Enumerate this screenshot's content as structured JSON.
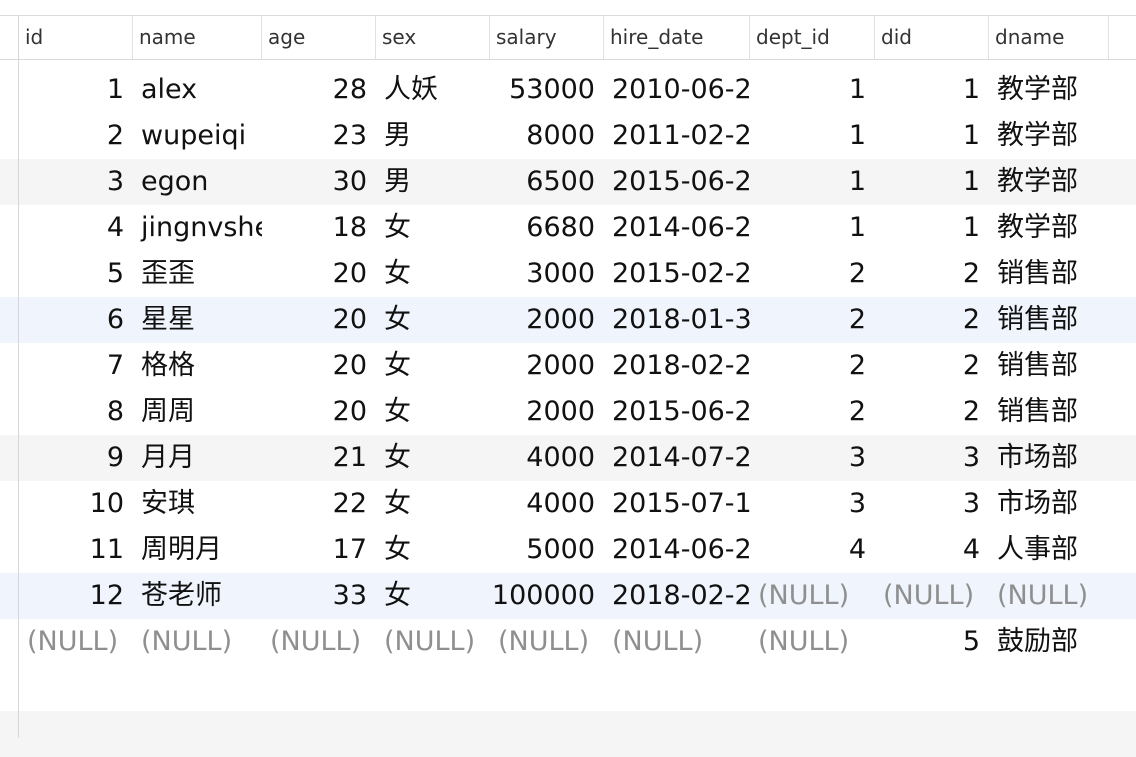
{
  "columns": [
    "id",
    "name",
    "age",
    "sex",
    "salary",
    "hire_date",
    "dept_id",
    "did",
    "dname"
  ],
  "null_label": "(NULL)",
  "rows": [
    {
      "id": "1",
      "name": "alex",
      "age": "28",
      "sex": "人妖",
      "salary": "53000",
      "hire_date": "2010-06-2",
      "dept_id": "1",
      "did": "1",
      "dname": "教学部"
    },
    {
      "id": "2",
      "name": "wupeiqi",
      "age": "23",
      "sex": "男",
      "salary": "8000",
      "hire_date": "2011-02-2",
      "dept_id": "1",
      "did": "1",
      "dname": "教学部"
    },
    {
      "id": "3",
      "name": "egon",
      "age": "30",
      "sex": "男",
      "salary": "6500",
      "hire_date": "2015-06-2",
      "dept_id": "1",
      "did": "1",
      "dname": "教学部"
    },
    {
      "id": "4",
      "name": "jingnvshe",
      "age": "18",
      "sex": "女",
      "salary": "6680",
      "hire_date": "2014-06-2",
      "dept_id": "1",
      "did": "1",
      "dname": "教学部"
    },
    {
      "id": "5",
      "name": "歪歪",
      "age": "20",
      "sex": "女",
      "salary": "3000",
      "hire_date": "2015-02-2",
      "dept_id": "2",
      "did": "2",
      "dname": "销售部"
    },
    {
      "id": "6",
      "name": "星星",
      "age": "20",
      "sex": "女",
      "salary": "2000",
      "hire_date": "2018-01-3",
      "dept_id": "2",
      "did": "2",
      "dname": "销售部"
    },
    {
      "id": "7",
      "name": "格格",
      "age": "20",
      "sex": "女",
      "salary": "2000",
      "hire_date": "2018-02-2",
      "dept_id": "2",
      "did": "2",
      "dname": "销售部"
    },
    {
      "id": "8",
      "name": "周周",
      "age": "20",
      "sex": "女",
      "salary": "2000",
      "hire_date": "2015-06-2",
      "dept_id": "2",
      "did": "2",
      "dname": "销售部"
    },
    {
      "id": "9",
      "name": "月月",
      "age": "21",
      "sex": "女",
      "salary": "4000",
      "hire_date": "2014-07-2",
      "dept_id": "3",
      "did": "3",
      "dname": "市场部"
    },
    {
      "id": "10",
      "name": "安琪",
      "age": "22",
      "sex": "女",
      "salary": "4000",
      "hire_date": "2015-07-1",
      "dept_id": "3",
      "did": "3",
      "dname": "市场部"
    },
    {
      "id": "11",
      "name": "周明月",
      "age": "17",
      "sex": "女",
      "salary": "5000",
      "hire_date": "2014-06-2",
      "dept_id": "4",
      "did": "4",
      "dname": "人事部"
    },
    {
      "id": "12",
      "name": "苍老师",
      "age": "33",
      "sex": "女",
      "salary": "100000",
      "hire_date": "2018-02-2",
      "dept_id": null,
      "did": null,
      "dname": null
    },
    {
      "id": null,
      "name": null,
      "age": null,
      "sex": null,
      "salary": null,
      "hire_date": null,
      "dept_id": null,
      "did": "5",
      "dname": "鼓励部"
    }
  ],
  "row_shading": [
    "",
    "",
    "stripe",
    "",
    "",
    "selected",
    "",
    "",
    "stripe",
    "",
    "",
    "selected",
    "",
    "",
    "stripe"
  ]
}
